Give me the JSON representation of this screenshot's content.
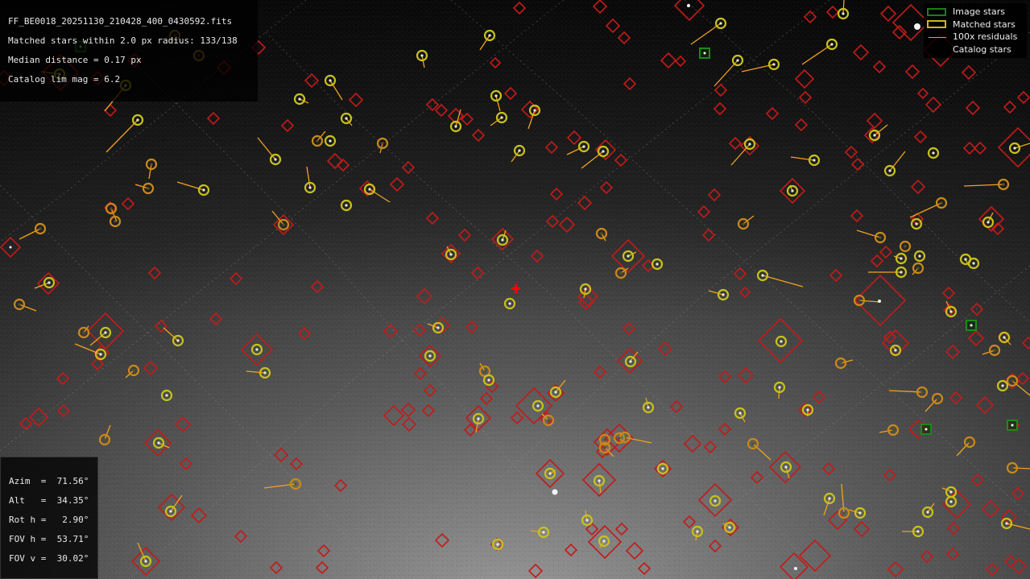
{
  "header": {
    "filename": "FF_BE0018_20251130_210428_400_0430592.fits",
    "matched_line": "Matched stars within 2.0 px radius: 133/138",
    "median_line": "Median distance = 0.17 px",
    "catalog_line": "Catalog lim mag = 6.2"
  },
  "pointing": {
    "azim": "Azim  =  71.56°",
    "alt": "Alt   =  34.35°",
    "roth": "Rot h =   2.90°",
    "fovh": "FOV h =  53.71°",
    "fovv": "FOV v =  30.02°"
  },
  "legend": {
    "image_stars": "Image stars",
    "matched_stars": "Matched stars",
    "residuals": "100x residuals",
    "catalog_stars": "Catalog stars"
  },
  "colors": {
    "catalog": "#c41a1a",
    "matched": "#c8c21b",
    "matched_faint": "#c9891a",
    "residual": "#f2a21d",
    "image_star": "#1b8a1b",
    "center_marker": "#ff0000"
  }
}
